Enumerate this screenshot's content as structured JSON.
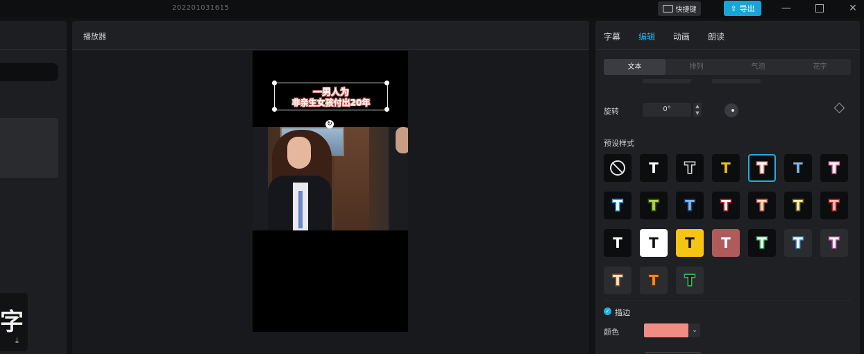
{
  "app": {
    "project_name": "202201031615",
    "shortcut_label": "快捷键",
    "export_label": "导出"
  },
  "player": {
    "title": "播放器",
    "subtitle_line1": "一男人为",
    "subtitle_line2": "非亲生女孩付出20年"
  },
  "left_panel": {
    "text_tile_glyph": "字"
  },
  "right_panel": {
    "tabs": [
      "字幕",
      "编辑",
      "动画",
      "朗读"
    ],
    "active_tab": "编辑",
    "subtabs": [
      "文本",
      "排列",
      "气泡",
      "花字"
    ],
    "active_subtab": "文本",
    "rotate_label": "旋转",
    "rotate_value": "0°",
    "preset_label": "预设样式",
    "stroke_label": "描边",
    "stroke_checked": true,
    "color_label": "颜色",
    "stroke_color": "#f08c83",
    "accent_color": "#1cb2e6"
  },
  "presets": [
    {
      "icon": "none-icon",
      "glyph": "",
      "fg": "#e6e6e6",
      "bg": "#0c0d0f"
    },
    {
      "glyph": "T",
      "fg": "#ffffff",
      "bg": "#0c0d0f"
    },
    {
      "glyph": "T",
      "fg": "#0c0d0f",
      "stroke": "#e0e0e0",
      "bg": "#0c0d0f"
    },
    {
      "glyph": "T",
      "fg": "#f2c21b",
      "bg": "#0c0d0f"
    },
    {
      "glyph": "T",
      "fg": "#ffffff",
      "stroke": "#f08c83",
      "bg": "#0c0d0f",
      "selected": true
    },
    {
      "glyph": "T",
      "fg": "#7fb6e6",
      "bg": "#0c0d0f"
    },
    {
      "glyph": "T",
      "fg": "#ffffff",
      "stroke": "#ef6fa8",
      "bg": "#0c0d0f"
    },
    {
      "glyph": "T",
      "fg": "#ffffff",
      "stroke": "#3aa0e8",
      "bg": "#0c0d0f"
    },
    {
      "glyph": "T",
      "fg": "#b8d14a",
      "stroke": "#3e5a12",
      "bg": "#0c0d0f"
    },
    {
      "glyph": "T",
      "fg": "#7fb6e6",
      "stroke": "#1c3c66",
      "bg": "#0c0d0f"
    },
    {
      "glyph": "T",
      "fg": "#ffffff",
      "stroke": "#d1242e",
      "bg": "#0c0d0f"
    },
    {
      "glyph": "T",
      "fg": "#f3d7c9",
      "stroke": "#c8613e",
      "bg": "#0c0d0f"
    },
    {
      "glyph": "T",
      "fg": "#f4eab2",
      "stroke": "#6b6120",
      "bg": "#0c0d0f"
    },
    {
      "glyph": "T",
      "fg": "#ffb3b3",
      "stroke": "#b82a2a",
      "bg": "#0c0d0f"
    },
    {
      "glyph": "T",
      "fg": "#ffffff",
      "bg": "#0c0d0f"
    },
    {
      "glyph": "T",
      "fg": "#111111",
      "bg": "#ffffff"
    },
    {
      "glyph": "T",
      "fg": "#111111",
      "bg": "#f6c514"
    },
    {
      "glyph": "T",
      "fg": "#ffffff",
      "bg": "#b05b5b"
    },
    {
      "glyph": "T",
      "fg": "#ffffff",
      "stroke": "#2fbf60",
      "bg": "#0c0d0f"
    },
    {
      "glyph": "T",
      "fg": "#ffffff",
      "stroke": "#3a8fe0",
      "bg": "#2a2c30"
    },
    {
      "glyph": "T",
      "fg": "#ffffff",
      "stroke": "#c04f9a",
      "bg": "#2a2c30"
    },
    {
      "glyph": "T",
      "fg": "#f6e3cf",
      "stroke": "#8a5a30",
      "bg": "#2a2c30"
    },
    {
      "glyph": "T",
      "fg": "#ff8a1c",
      "stroke": "#5a2a00",
      "bg": "#2a2c30"
    },
    {
      "glyph": "T",
      "fg": "#111111",
      "stroke": "#2fbf60",
      "bg": "#2a2c30"
    }
  ]
}
